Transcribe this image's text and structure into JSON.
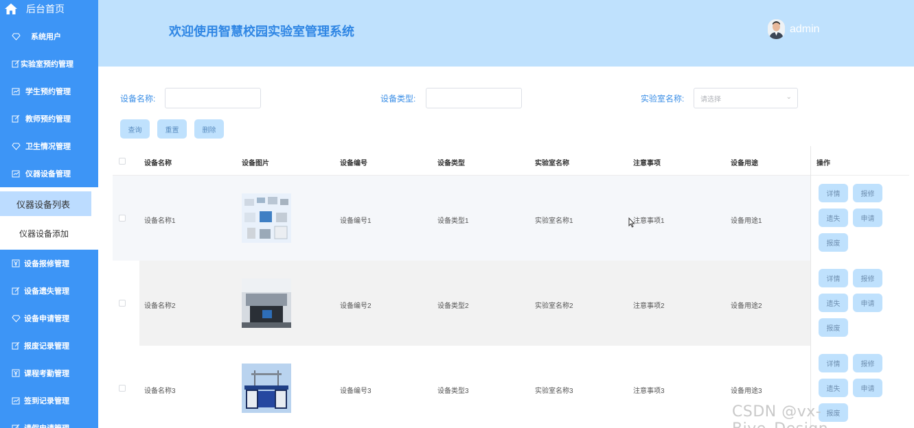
{
  "sidebar": {
    "home_label": "后台首页",
    "items": [
      {
        "label": "系统用户",
        "icon": "diamond-icon"
      },
      {
        "label": "实验室预约管理",
        "icon": "edit-icon"
      },
      {
        "label": "学生预约管理",
        "icon": "chart-icon"
      },
      {
        "label": "教师预约管理",
        "icon": "edit-icon"
      },
      {
        "label": "卫生情况管理",
        "icon": "diamond-icon"
      },
      {
        "label": "仪器设备管理",
        "icon": "chart-icon"
      }
    ],
    "submenu": [
      {
        "label": "仪器设备列表",
        "active": true
      },
      {
        "label": "仪器设备添加",
        "active": false
      }
    ],
    "items_after": [
      {
        "label": "设备报修管理",
        "icon": "yen-icon"
      },
      {
        "label": "设备遗失管理",
        "icon": "edit-icon"
      },
      {
        "label": "设备申请管理",
        "icon": "diamond-icon"
      },
      {
        "label": "报废记录管理",
        "icon": "edit-icon"
      },
      {
        "label": "课程考勤管理",
        "icon": "yen-icon"
      },
      {
        "label": "签到记录管理",
        "icon": "chart-icon"
      },
      {
        "label": "请假申请管理",
        "icon": "edit-icon"
      }
    ]
  },
  "header": {
    "title": "欢迎使用智慧校园实验室管理系统",
    "username": "admin"
  },
  "search": {
    "name_label": "设备名称:",
    "type_label": "设备类型:",
    "lab_label": "实验室名称:",
    "lab_placeholder": "请选择",
    "query_button": "查询",
    "reset_button": "重置",
    "delete_button": "删除"
  },
  "table": {
    "columns": [
      "设备名称",
      "设备图片",
      "设备编号",
      "设备类型",
      "实验室名称",
      "注意事项",
      "设备用途",
      "操作"
    ],
    "rows": [
      {
        "name": "设备名称1",
        "code": "设备编号1",
        "type": "设备类型1",
        "lab": "实验室名称1",
        "notes": "注意事项1",
        "usage": "设备用途1"
      },
      {
        "name": "设备名称2",
        "code": "设备编号2",
        "type": "设备类型2",
        "lab": "实验室名称2",
        "notes": "注意事项2",
        "usage": "设备用途2"
      },
      {
        "name": "设备名称3",
        "code": "设备编号3",
        "type": "设备类型3",
        "lab": "实验室名称3",
        "notes": "注意事项3",
        "usage": "设备用途3"
      }
    ],
    "actions": {
      "detail": "详情",
      "repair": "报修",
      "lost": "遗失",
      "apply": "申请",
      "scrap": "报废"
    }
  },
  "watermark": "CSDN @vx-Biye_Design",
  "colors": {
    "sidebar": "#3d95f6",
    "header": "#bfe1fd",
    "title": "#2f86e4",
    "button": "#bfe1fd"
  }
}
